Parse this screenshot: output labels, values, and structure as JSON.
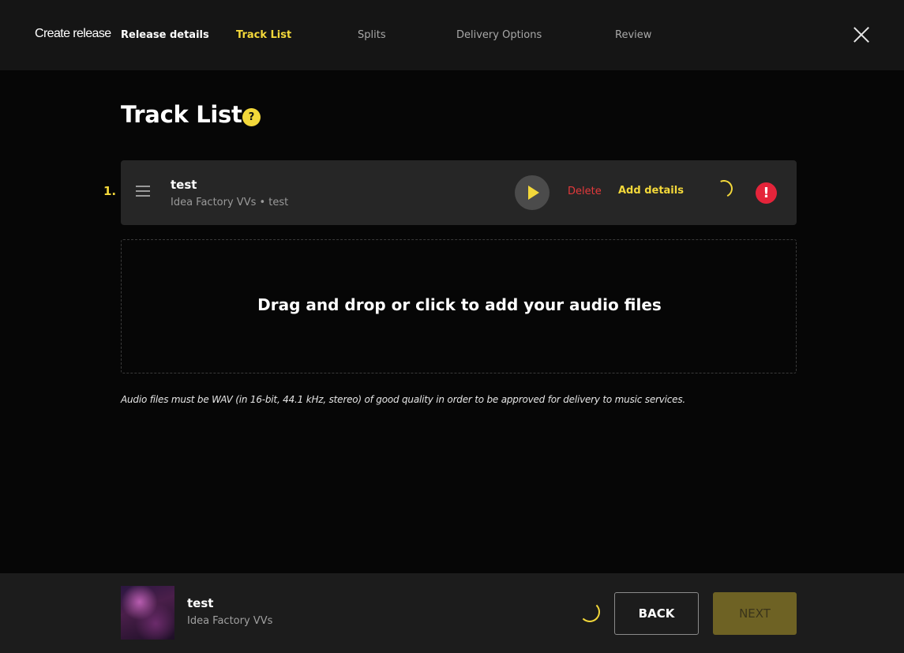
{
  "header": {
    "create_label": "Create release",
    "steps": [
      {
        "label": "Release details",
        "state": "done"
      },
      {
        "label": "Track List",
        "state": "active"
      },
      {
        "label": "Splits",
        "state": "pending"
      },
      {
        "label": "Delivery Options",
        "state": "pending"
      },
      {
        "label": "Review",
        "state": "pending"
      }
    ],
    "close_icon": "close-icon"
  },
  "main": {
    "title": "Track List",
    "help_icon_glyph": "?",
    "tracks": [
      {
        "index": "1.",
        "title": "test",
        "subtitle": "Idea Factory VVs • test",
        "delete_label": "Delete",
        "add_details_label": "Add details",
        "error_glyph": "!"
      }
    ],
    "dropzone_text": "Drag and drop or click to add your audio files",
    "note": "Audio files must be WAV (in 16-bit, 44.1 kHz, stereo) of good quality in order to be approved for delivery to music services."
  },
  "footer": {
    "release_title": "test",
    "release_artist": "Idea Factory VVs",
    "back_label": "BACK",
    "next_label": "NEXT"
  },
  "colors": {
    "accent": "#f3d83a",
    "danger": "#e4393b",
    "background": "#060606",
    "topbar": "#151515",
    "row": "#262626"
  }
}
